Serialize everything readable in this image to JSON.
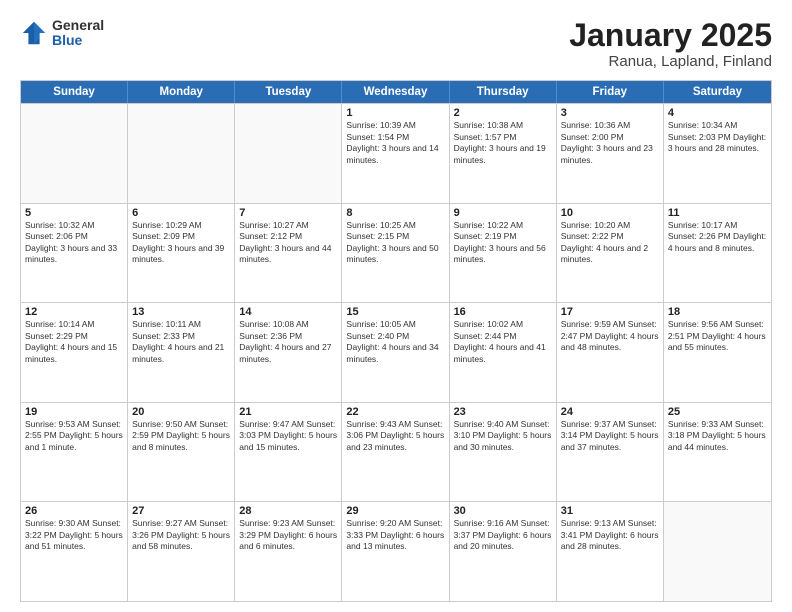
{
  "logo": {
    "general": "General",
    "blue": "Blue"
  },
  "title": "January 2025",
  "subtitle": "Ranua, Lapland, Finland",
  "header_days": [
    "Sunday",
    "Monday",
    "Tuesday",
    "Wednesday",
    "Thursday",
    "Friday",
    "Saturday"
  ],
  "weeks": [
    [
      {
        "day": "",
        "info": "",
        "empty": true
      },
      {
        "day": "",
        "info": "",
        "empty": true
      },
      {
        "day": "",
        "info": "",
        "empty": true
      },
      {
        "day": "1",
        "info": "Sunrise: 10:39 AM\nSunset: 1:54 PM\nDaylight: 3 hours\nand 14 minutes.",
        "empty": false
      },
      {
        "day": "2",
        "info": "Sunrise: 10:38 AM\nSunset: 1:57 PM\nDaylight: 3 hours\nand 19 minutes.",
        "empty": false
      },
      {
        "day": "3",
        "info": "Sunrise: 10:36 AM\nSunset: 2:00 PM\nDaylight: 3 hours\nand 23 minutes.",
        "empty": false
      },
      {
        "day": "4",
        "info": "Sunrise: 10:34 AM\nSunset: 2:03 PM\nDaylight: 3 hours\nand 28 minutes.",
        "empty": false
      }
    ],
    [
      {
        "day": "5",
        "info": "Sunrise: 10:32 AM\nSunset: 2:06 PM\nDaylight: 3 hours\nand 33 minutes.",
        "empty": false
      },
      {
        "day": "6",
        "info": "Sunrise: 10:29 AM\nSunset: 2:09 PM\nDaylight: 3 hours\nand 39 minutes.",
        "empty": false
      },
      {
        "day": "7",
        "info": "Sunrise: 10:27 AM\nSunset: 2:12 PM\nDaylight: 3 hours\nand 44 minutes.",
        "empty": false
      },
      {
        "day": "8",
        "info": "Sunrise: 10:25 AM\nSunset: 2:15 PM\nDaylight: 3 hours\nand 50 minutes.",
        "empty": false
      },
      {
        "day": "9",
        "info": "Sunrise: 10:22 AM\nSunset: 2:19 PM\nDaylight: 3 hours\nand 56 minutes.",
        "empty": false
      },
      {
        "day": "10",
        "info": "Sunrise: 10:20 AM\nSunset: 2:22 PM\nDaylight: 4 hours\nand 2 minutes.",
        "empty": false
      },
      {
        "day": "11",
        "info": "Sunrise: 10:17 AM\nSunset: 2:26 PM\nDaylight: 4 hours\nand 8 minutes.",
        "empty": false
      }
    ],
    [
      {
        "day": "12",
        "info": "Sunrise: 10:14 AM\nSunset: 2:29 PM\nDaylight: 4 hours\nand 15 minutes.",
        "empty": false
      },
      {
        "day": "13",
        "info": "Sunrise: 10:11 AM\nSunset: 2:33 PM\nDaylight: 4 hours\nand 21 minutes.",
        "empty": false
      },
      {
        "day": "14",
        "info": "Sunrise: 10:08 AM\nSunset: 2:36 PM\nDaylight: 4 hours\nand 27 minutes.",
        "empty": false
      },
      {
        "day": "15",
        "info": "Sunrise: 10:05 AM\nSunset: 2:40 PM\nDaylight: 4 hours\nand 34 minutes.",
        "empty": false
      },
      {
        "day": "16",
        "info": "Sunrise: 10:02 AM\nSunset: 2:44 PM\nDaylight: 4 hours\nand 41 minutes.",
        "empty": false
      },
      {
        "day": "17",
        "info": "Sunrise: 9:59 AM\nSunset: 2:47 PM\nDaylight: 4 hours\nand 48 minutes.",
        "empty": false
      },
      {
        "day": "18",
        "info": "Sunrise: 9:56 AM\nSunset: 2:51 PM\nDaylight: 4 hours\nand 55 minutes.",
        "empty": false
      }
    ],
    [
      {
        "day": "19",
        "info": "Sunrise: 9:53 AM\nSunset: 2:55 PM\nDaylight: 5 hours\nand 1 minute.",
        "empty": false
      },
      {
        "day": "20",
        "info": "Sunrise: 9:50 AM\nSunset: 2:59 PM\nDaylight: 5 hours\nand 8 minutes.",
        "empty": false
      },
      {
        "day": "21",
        "info": "Sunrise: 9:47 AM\nSunset: 3:03 PM\nDaylight: 5 hours\nand 15 minutes.",
        "empty": false
      },
      {
        "day": "22",
        "info": "Sunrise: 9:43 AM\nSunset: 3:06 PM\nDaylight: 5 hours\nand 23 minutes.",
        "empty": false
      },
      {
        "day": "23",
        "info": "Sunrise: 9:40 AM\nSunset: 3:10 PM\nDaylight: 5 hours\nand 30 minutes.",
        "empty": false
      },
      {
        "day": "24",
        "info": "Sunrise: 9:37 AM\nSunset: 3:14 PM\nDaylight: 5 hours\nand 37 minutes.",
        "empty": false
      },
      {
        "day": "25",
        "info": "Sunrise: 9:33 AM\nSunset: 3:18 PM\nDaylight: 5 hours\nand 44 minutes.",
        "empty": false
      }
    ],
    [
      {
        "day": "26",
        "info": "Sunrise: 9:30 AM\nSunset: 3:22 PM\nDaylight: 5 hours\nand 51 minutes.",
        "empty": false
      },
      {
        "day": "27",
        "info": "Sunrise: 9:27 AM\nSunset: 3:26 PM\nDaylight: 5 hours\nand 58 minutes.",
        "empty": false
      },
      {
        "day": "28",
        "info": "Sunrise: 9:23 AM\nSunset: 3:29 PM\nDaylight: 6 hours\nand 6 minutes.",
        "empty": false
      },
      {
        "day": "29",
        "info": "Sunrise: 9:20 AM\nSunset: 3:33 PM\nDaylight: 6 hours\nand 13 minutes.",
        "empty": false
      },
      {
        "day": "30",
        "info": "Sunrise: 9:16 AM\nSunset: 3:37 PM\nDaylight: 6 hours\nand 20 minutes.",
        "empty": false
      },
      {
        "day": "31",
        "info": "Sunrise: 9:13 AM\nSunset: 3:41 PM\nDaylight: 6 hours\nand 28 minutes.",
        "empty": false
      },
      {
        "day": "",
        "info": "",
        "empty": true
      }
    ]
  ]
}
